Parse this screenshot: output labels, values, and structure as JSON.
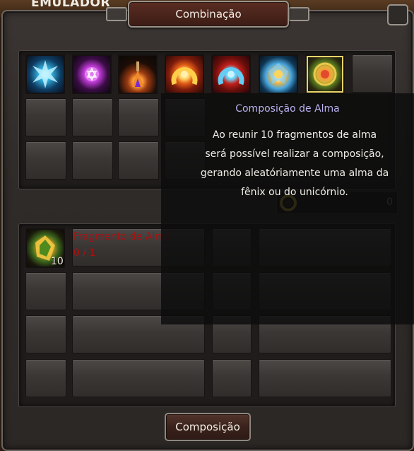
{
  "background": {
    "corner_text": "EMULADOR"
  },
  "window": {
    "title": "Combinação"
  },
  "materials_top": [
    {
      "icon": "blue-star-gem-icon"
    },
    {
      "icon": "purple-star-gem-icon"
    },
    {
      "icon": "potion-flask-icon"
    },
    {
      "icon": "orange-horseshoe-icon"
    },
    {
      "icon": "red-horseshoe-icon"
    },
    {
      "icon": "blue-wings-icon"
    },
    {
      "icon": "gold-medal-icon"
    }
  ],
  "tooltip": {
    "title": "Composição de Alma",
    "line1": "Ao reunir 10 fragmentos de alma",
    "line2": "será possível realizar a composição,",
    "line3": "gerando aleatóriamente uma alma da",
    "line4": "fênix ou do unicórnio."
  },
  "currency": {
    "icon": "gold-ring-icon",
    "count": "0"
  },
  "requirement": {
    "icon": "soul-fragment-icon",
    "stack": "10",
    "name": "Fragmento de Alma",
    "quantity": "0 / 1"
  },
  "actions": {
    "compose_label": "Composição"
  },
  "colors": {
    "tooltip_title": "#b9b2ef",
    "requirement_text": "#b30d0d"
  }
}
